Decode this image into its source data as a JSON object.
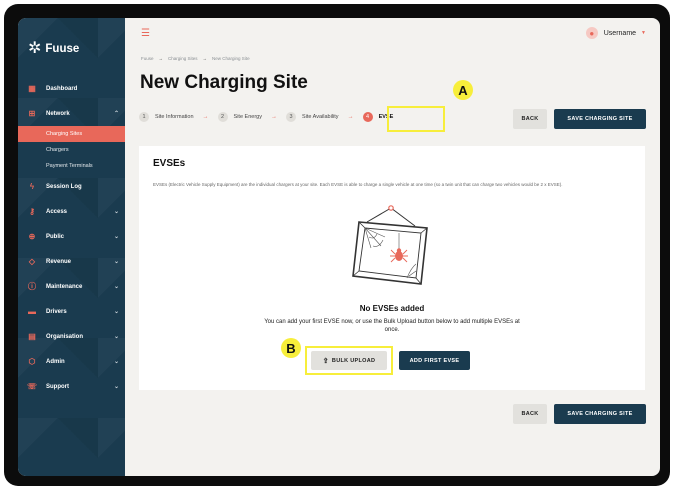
{
  "app": {
    "logo": "Fuuse",
    "logo_icon": "fuuse-star-icon"
  },
  "sidebar": {
    "items": [
      {
        "label": "Dashboard",
        "icon": "dashboard-icon",
        "has_chevron": false
      },
      {
        "label": "Network",
        "icon": "network-icon",
        "has_chevron": true,
        "expanded": true,
        "children": [
          "Charging Sites",
          "Chargers",
          "Payment Terminals"
        ],
        "active_child": "Charging Sites"
      },
      {
        "label": "Session Log",
        "icon": "lightning-icon",
        "has_chevron": false
      },
      {
        "label": "Access",
        "icon": "key-icon",
        "has_chevron": true
      },
      {
        "label": "Public",
        "icon": "globe-icon",
        "has_chevron": true
      },
      {
        "label": "Revenue",
        "icon": "tag-icon",
        "has_chevron": true
      },
      {
        "label": "Maintenance",
        "icon": "alert-icon",
        "has_chevron": true
      },
      {
        "label": "Drivers",
        "icon": "car-icon",
        "has_chevron": true
      },
      {
        "label": "Organisation",
        "icon": "building-icon",
        "has_chevron": true
      },
      {
        "label": "Admin",
        "icon": "shield-icon",
        "has_chevron": true
      },
      {
        "label": "Support",
        "icon": "phone-icon",
        "has_chevron": true
      }
    ]
  },
  "header": {
    "username": "Username"
  },
  "breadcrumb": [
    "Fuuse",
    "Charging Sites",
    "New Charging Site"
  ],
  "page": {
    "title": "New Charging Site"
  },
  "steps": [
    {
      "num": "1",
      "label": "Site Information",
      "active": false
    },
    {
      "num": "2",
      "label": "Site Energy",
      "active": false
    },
    {
      "num": "3",
      "label": "Site Availability",
      "active": false
    },
    {
      "num": "4",
      "label": "EVSE",
      "active": true
    }
  ],
  "actions": {
    "back": "BACK",
    "save": "SAVE CHARGING SITE"
  },
  "card": {
    "heading": "EVSEs",
    "description": "EVSEs (Electric Vehicle Supply Equipment) are the individual chargers at your site. Each EVSE is able to charge a single vehicle at one time (so a twin unit that can charge two vehicles would be 2 x EVSE).",
    "empty_title": "No EVSEs added",
    "empty_text": "You can add your first EVSE now, or use the Bulk Upload button below to add multiple EVSEs at once.",
    "bulk_upload": "BULK UPLOAD",
    "add_first": "ADD FIRST EVSE"
  },
  "annotations": {
    "a": "A",
    "b": "B"
  },
  "colors": {
    "accent": "#e8685a",
    "navy": "#1a3b4f",
    "highlight": "#f7ee3b",
    "background": "#f3f2ef"
  }
}
